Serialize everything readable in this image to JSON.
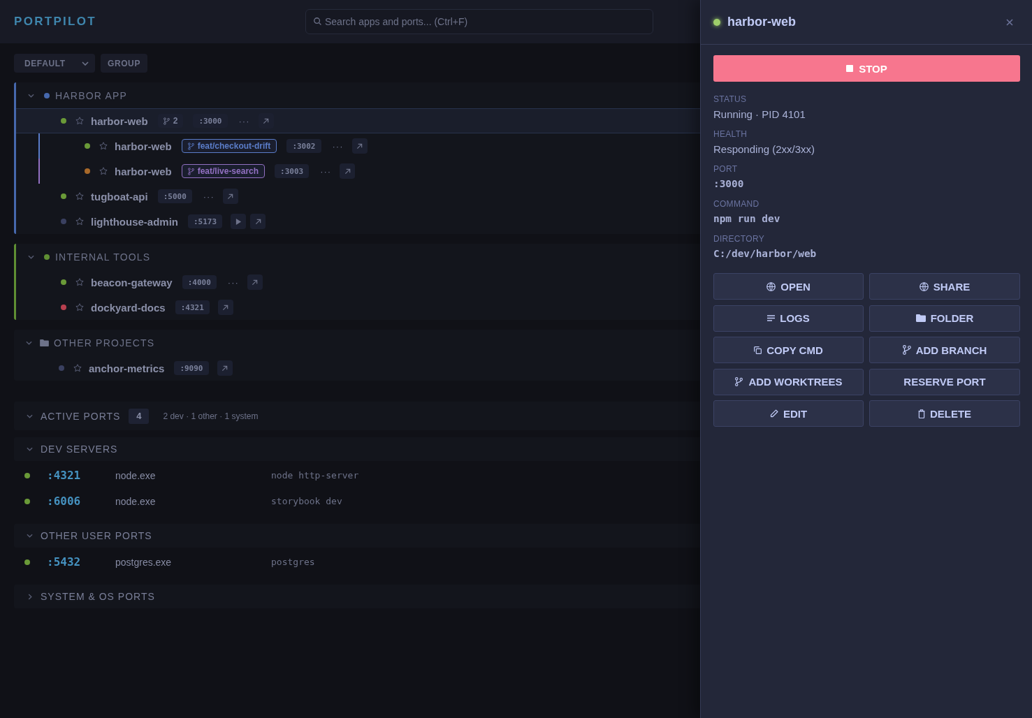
{
  "app": {
    "header": {
      "logo": "PORTPILOT",
      "search": {
        "placeholder": "Search apps and ports... (Ctrl+F)"
      }
    },
    "toolbar": {
      "view_select": "DEFAULT",
      "group_button": "GROUP"
    },
    "groups": [
      {
        "kind": "project",
        "name": "HARBOR APP",
        "color": "#4668ad",
        "expanded": true,
        "apps": [
          {
            "name": "harbor-web",
            "color": "#6a9a38",
            "starred": false,
            "selected": true,
            "branches": "2",
            "port": ":3000",
            "more": "···",
            "actions": [
              {
                "kind": "open"
              }
            ],
            "children": [
              {
                "name": "harbor-web",
                "color": "#6a9a38",
                "starred": false,
                "selected": false,
                "branch": {
                  "name": "feat/checkout-drift",
                  "color": "#5a7cc8"
                },
                "port": ":3002",
                "more": "···",
                "actions": [
                  {
                    "kind": "open"
                  }
                ]
              },
              {
                "name": "harbor-web",
                "color": "#a8692a",
                "starred": false,
                "selected": false,
                "branch": {
                  "name": "feat/live-search",
                  "color": "#9270c2"
                },
                "port": ":3003",
                "more": "···",
                "actions": [
                  {
                    "kind": "open"
                  }
                ]
              }
            ]
          },
          {
            "name": "tugboat-api",
            "color": "#6a9a38",
            "starred": false,
            "selected": false,
            "port": ":5000",
            "more": "···",
            "actions": [
              {
                "kind": "open"
              }
            ]
          },
          {
            "name": "lighthouse-admin",
            "color": "#3a4060",
            "starred": false,
            "selected": false,
            "port": ":5173",
            "actions": [
              {
                "kind": "start"
              },
              {
                "kind": "open"
              }
            ]
          }
        ]
      },
      {
        "kind": "project",
        "name": "INTERNAL TOOLS",
        "color": "#5f8f33",
        "expanded": true,
        "apps": [
          {
            "name": "beacon-gateway",
            "color": "#6a9a38",
            "starred": false,
            "selected": false,
            "port": ":4000",
            "more": "···",
            "actions": [
              {
                "kind": "open"
              }
            ]
          },
          {
            "name": "dockyard-docs",
            "color": "#b8404f",
            "starred": false,
            "selected": false,
            "port": ":4321",
            "actions": [
              {
                "kind": "open"
              }
            ]
          }
        ]
      },
      {
        "kind": "folder",
        "name": "OTHER PROJECTS",
        "expanded": true,
        "apps": [
          {
            "name": "anchor-metrics",
            "color": "#3a4060",
            "starred": false,
            "selected": false,
            "port": ":9090",
            "actions": [
              {
                "kind": "open"
              }
            ]
          }
        ]
      }
    ],
    "ports": {
      "title": "ACTIVE PORTS",
      "expanded": true,
      "count": "4",
      "summary": "2 dev · 1 other · 1 system",
      "categories": [
        {
          "title": "DEV SERVERS",
          "expanded": true,
          "rows": [
            {
              "color": "#6a9a38",
              "port": ":4321",
              "process": "node.exe",
              "command": "node http-server"
            },
            {
              "color": "#6a9a38",
              "port": ":6006",
              "process": "node.exe",
              "command": "storybook dev"
            }
          ]
        },
        {
          "title": "OTHER USER PORTS",
          "expanded": true,
          "rows": [
            {
              "color": "#6a9a38",
              "port": ":5432",
              "process": "postgres.exe",
              "command": "postgres"
            }
          ]
        },
        {
          "title": "SYSTEM & OS PORTS",
          "expanded": false
        }
      ]
    }
  },
  "detail_panel": {
    "title": "harbor-web",
    "color": "#9ece6a",
    "primary_action": {
      "kind": "stop",
      "label": "STOP"
    },
    "fields": [
      {
        "kind": "text",
        "label": "STATUS",
        "value": "Running · PID 4101"
      },
      {
        "kind": "text",
        "label": "HEALTH",
        "value": "Responding (2xx/3xx)"
      },
      {
        "kind": "mono",
        "label": "PORT",
        "value": ":3000"
      },
      {
        "kind": "mono",
        "label": "COMMAND",
        "value": "npm run dev"
      },
      {
        "kind": "mono",
        "label": "DIRECTORY",
        "value": "C:/dev/harbor/web"
      }
    ],
    "actions": [
      {
        "kind": "open",
        "label": "OPEN"
      },
      {
        "kind": "share",
        "label": "SHARE"
      },
      {
        "kind": "logs",
        "label": "LOGS"
      },
      {
        "kind": "folder",
        "label": "FOLDER"
      },
      {
        "kind": "copy",
        "label": "COPY CMD"
      },
      {
        "kind": "branch",
        "label": "ADD BRANCH"
      },
      {
        "kind": "worktrees",
        "label": "ADD WORKTREES"
      },
      {
        "kind": "reserve",
        "label": "RESERVE PORT"
      },
      {
        "kind": "edit",
        "label": "EDIT"
      },
      {
        "kind": "delete",
        "label": "DELETE"
      }
    ]
  }
}
